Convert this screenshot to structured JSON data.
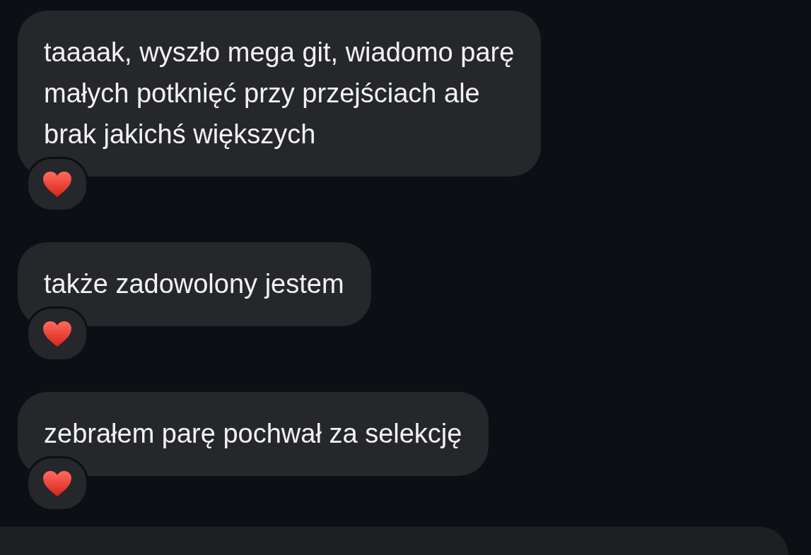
{
  "messages": [
    {
      "text": "taaaak, wyszło mega git, wiadomo parę\nmałych potknięć przy przejściach ale\nbrak jakichś większych",
      "reacted": true
    },
    {
      "text": "także zadowolony jestem",
      "reacted": true
    },
    {
      "text": "zebrałem parę pochwał za selekcję",
      "reacted": true
    }
  ]
}
